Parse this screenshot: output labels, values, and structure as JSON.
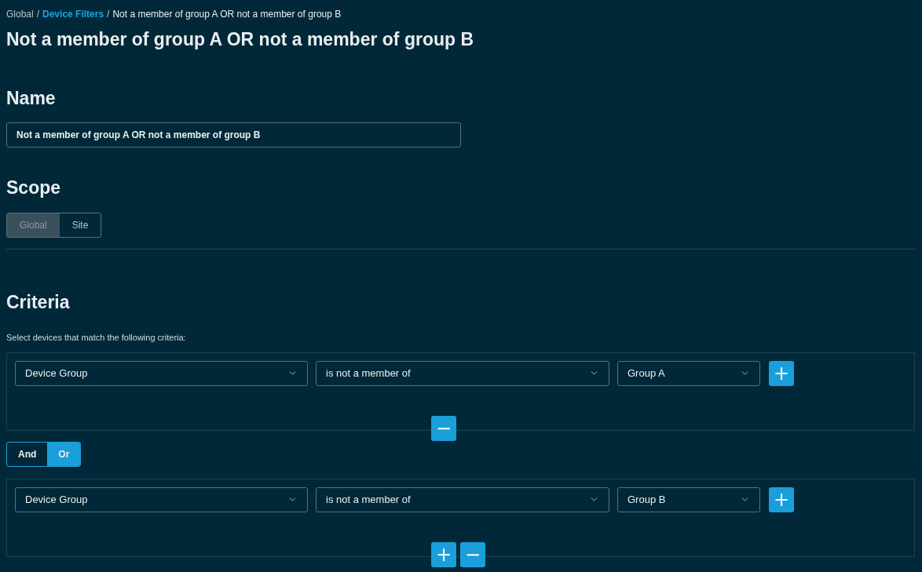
{
  "breadcrumb_separator": "/",
  "breadcrumb": [
    {
      "label": "Global",
      "link": false
    },
    {
      "label": "Device Filters",
      "link": true
    },
    {
      "label": "Not a member of group A OR not a member of group B",
      "link": false
    }
  ],
  "title": "Not a member of group A OR not a member of group B",
  "name": {
    "heading": "Name",
    "value": "Not a member of group A OR not a member of group B"
  },
  "scope": {
    "heading": "Scope",
    "options": [
      {
        "label": "Global",
        "selected": true
      },
      {
        "label": "Site",
        "selected": false
      }
    ]
  },
  "criteria": {
    "heading": "Criteria",
    "instruction": "Select devices that match the following criteria:",
    "groups": [
      {
        "fields": [
          "Device Group",
          "is not a member of",
          "Group A"
        ],
        "row_action": "+",
        "actions": [
          "−"
        ]
      },
      {
        "fields": [
          "Device Group",
          "is not a member of",
          "Group B"
        ],
        "row_action": "+",
        "actions": [
          "+",
          "−"
        ]
      }
    ],
    "operator": [
      {
        "label": "And",
        "selected": false
      },
      {
        "label": "Or",
        "selected": true
      }
    ]
  }
}
